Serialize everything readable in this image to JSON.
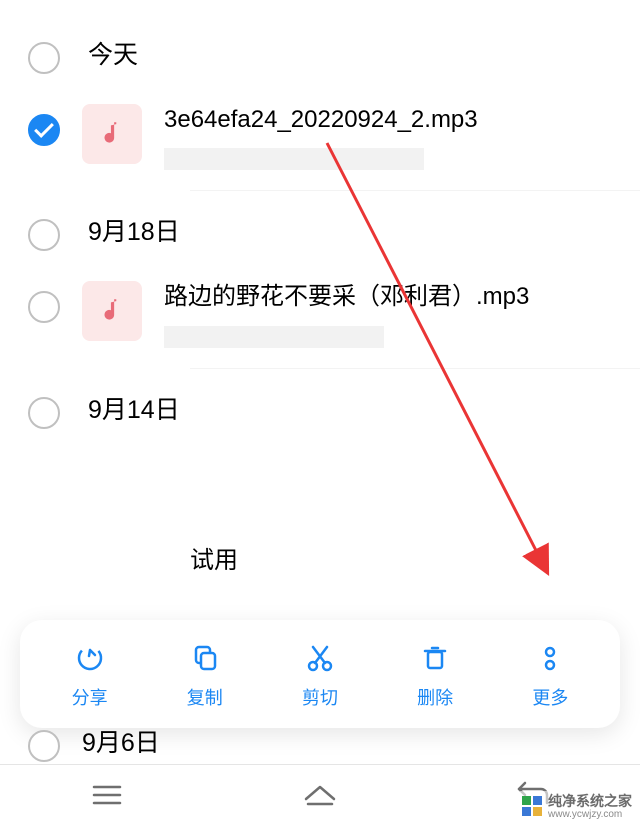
{
  "sections": [
    {
      "title": "今天"
    },
    {
      "title": "9月18日"
    },
    {
      "title": "9月14日"
    },
    {
      "title": "9月6日"
    }
  ],
  "files": [
    {
      "name": "3e64efa24_20220924_2.mp3",
      "selected": true
    },
    {
      "name": "路边的野花不要采（邓利君）.mp3",
      "selected": false
    }
  ],
  "partial_file_hint": "试用",
  "action_bar": {
    "share": "分享",
    "copy": "复制",
    "cut": "剪切",
    "delete": "删除",
    "more": "更多"
  },
  "watermark": {
    "line1": "纯净系统之家",
    "line2": "www.ycwjzy.com"
  },
  "colors": {
    "accent": "#1b87f3",
    "arrow": "#ea3535"
  }
}
